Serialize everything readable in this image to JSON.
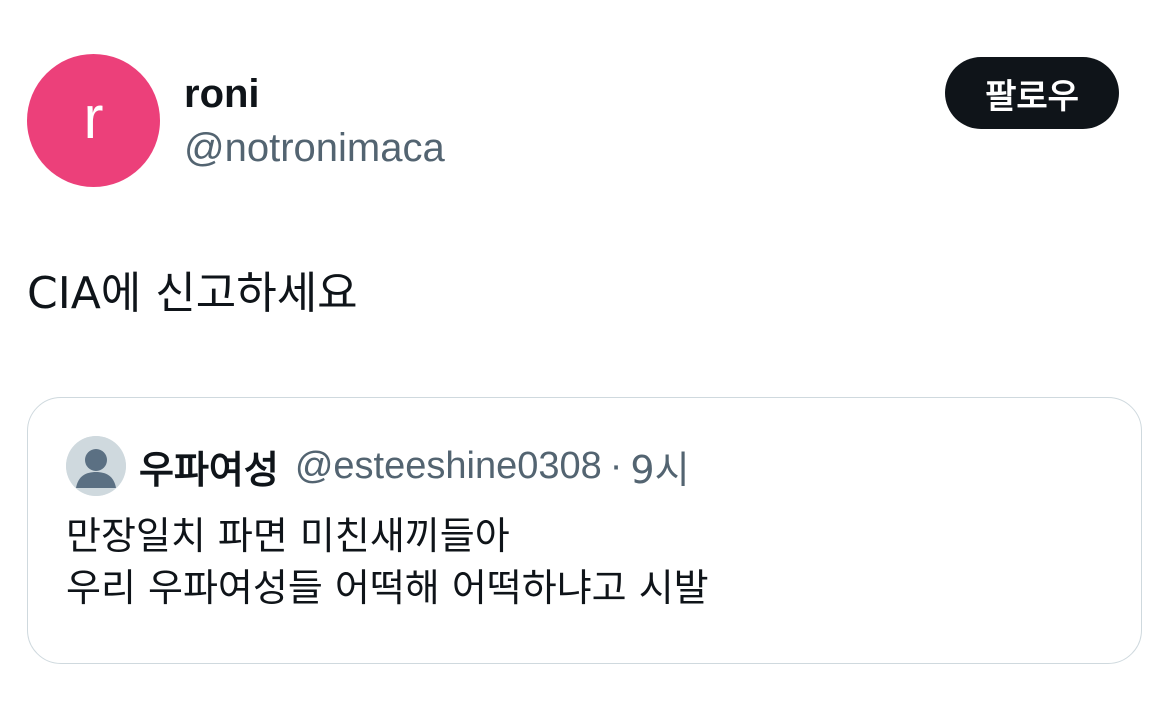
{
  "author": {
    "display_name": "roni",
    "handle": "@notronimaca",
    "avatar_letter": "r",
    "avatar_color": "#ec407a"
  },
  "follow_button": {
    "label": "팔로우"
  },
  "tweet": {
    "text": "CIA에 신고하세요"
  },
  "quoted_tweet": {
    "display_name": "우파여성",
    "handle": "@esteeshine0308",
    "separator": "·",
    "time": "9시",
    "avatar_icon": "default-user-avatar-icon",
    "lines": [
      "만장일치 파면 미친새끼들아",
      "우리 우파여성들 어떡해 어떡하냐고 시발"
    ]
  }
}
